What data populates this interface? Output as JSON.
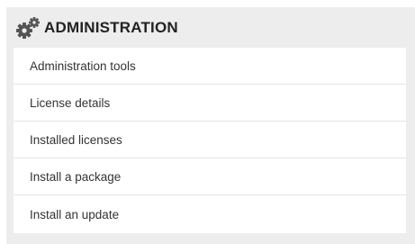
{
  "panel": {
    "title": "ADMINISTRATION",
    "icon": "gears-icon",
    "colors": {
      "panel_background": "#ededed",
      "item_background": "#ffffff",
      "icon": "#555555",
      "title": "#222222",
      "item_text": "#333333"
    },
    "items": [
      {
        "label": "Administration tools"
      },
      {
        "label": "License details"
      },
      {
        "label": "Installed licenses"
      },
      {
        "label": "Install a package"
      },
      {
        "label": "Install an update"
      }
    ]
  }
}
